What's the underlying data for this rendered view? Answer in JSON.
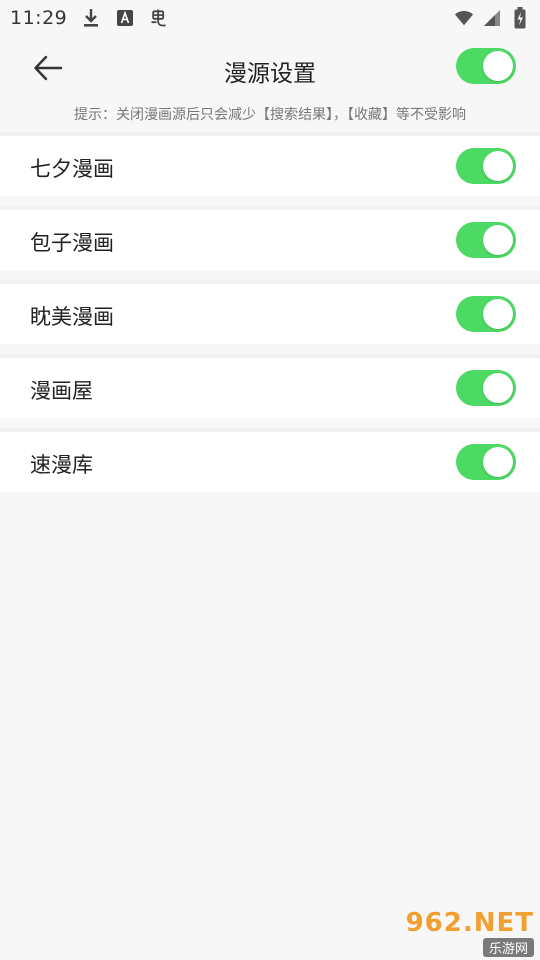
{
  "status_bar": {
    "time": "11:29",
    "icons": [
      "download-icon",
      "text-a-icon",
      "bug-icon"
    ],
    "right_icons": [
      "wifi-icon",
      "signal-icon",
      "battery-icon"
    ]
  },
  "header": {
    "title": "漫源设置",
    "back_icon": "arrow-left-icon",
    "master_toggle_on": true
  },
  "hint": "提示：关闭漫画源后只会减少【搜索结果】，【收藏】等不受影响",
  "sources": [
    {
      "label": "七夕漫画",
      "enabled": true
    },
    {
      "label": "包子漫画",
      "enabled": true
    },
    {
      "label": "眈美漫画",
      "enabled": true
    },
    {
      "label": "漫画屋",
      "enabled": true
    },
    {
      "label": "速漫库",
      "enabled": true
    }
  ],
  "watermark": {
    "top": "962.NET",
    "bottom": "乐游网"
  },
  "colors": {
    "toggle_on": "#4cd964",
    "background": "#f7f7f7"
  }
}
